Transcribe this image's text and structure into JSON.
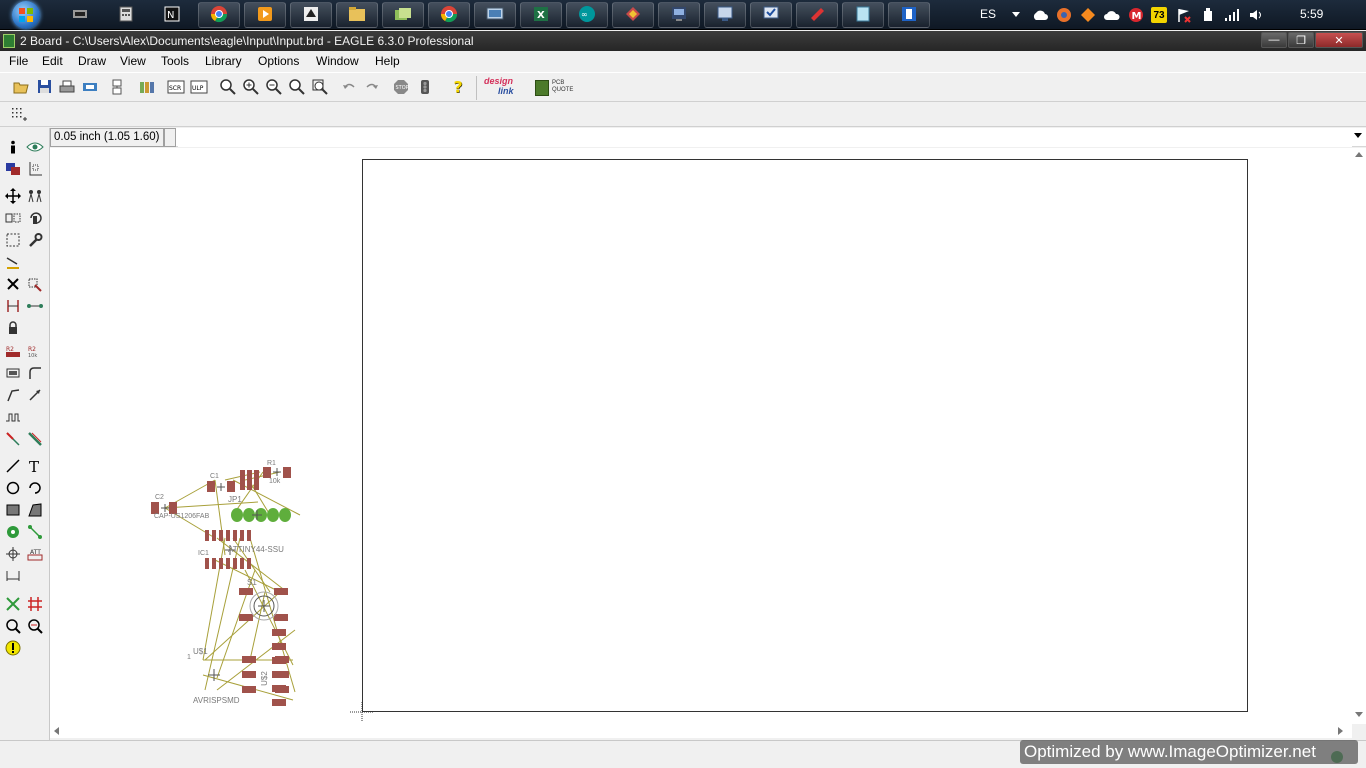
{
  "taskbar": {
    "language": "ES",
    "clock": "5:59",
    "badge_count": "73",
    "apps": [
      {
        "name": "start-orb"
      },
      {
        "name": "terminal"
      },
      {
        "name": "calculator"
      },
      {
        "name": "netbeans"
      },
      {
        "name": "chrome"
      },
      {
        "name": "media"
      },
      {
        "name": "inkscape"
      },
      {
        "name": "explorer"
      },
      {
        "name": "folders"
      },
      {
        "name": "chrome-2"
      },
      {
        "name": "remote"
      },
      {
        "name": "excel"
      },
      {
        "name": "arduino"
      },
      {
        "name": "app-red"
      },
      {
        "name": "app-dark"
      },
      {
        "name": "app-monitor"
      },
      {
        "name": "app-monitor-2"
      },
      {
        "name": "app-red-2"
      },
      {
        "name": "notes"
      },
      {
        "name": "app-blue"
      }
    ],
    "icon_names": {
      "tray_cloud": "cloud-icon",
      "tray_fire": "firefox-icon",
      "tray_red": "app-red-icon",
      "tray_mega": "mega-icon",
      "tray_flag": "flag-icon",
      "tray_usb": "usb-icon",
      "tray_signal": "signal-icon",
      "tray_volume": "volume-icon"
    }
  },
  "window": {
    "title": "2 Board - C:\\Users\\Alex\\Documents\\eagle\\Input\\Input.brd - EAGLE 6.3.0 Professional",
    "minimize": "—",
    "maximize": "❐",
    "close": "✕"
  },
  "menu": [
    "File",
    "Edit",
    "Draw",
    "View",
    "Tools",
    "Library",
    "Options",
    "Window",
    "Help"
  ],
  "toolbar": {
    "design_link": "design",
    "design_link_2": "link",
    "pcb_quote": "PCB",
    "pcb_quote_2": "QUOTE"
  },
  "coords": {
    "grid": "0.05 inch (1.05 1.60)",
    "command_value": ""
  },
  "pcb": {
    "labels": {
      "c1": "C1",
      "c2": "C2",
      "c2_value": "CAP-US1206FAB",
      "r1": "R1",
      "r1_value": "10k",
      "jp1": "JP1",
      "ic1": "IC1",
      "ic1_value": "ATTINY44-SSU",
      "s1": "S1",
      "u1": "U$1",
      "u1_pin": "1",
      "u1_value": "AVRISPSMD",
      "u2": "U$2"
    }
  },
  "watermark": "Optimized by www.ImageOptimizer.net",
  "colors": {
    "pad": "#a0524b",
    "airwire": "#a8a03a",
    "pad_green": "#5fae3c"
  }
}
